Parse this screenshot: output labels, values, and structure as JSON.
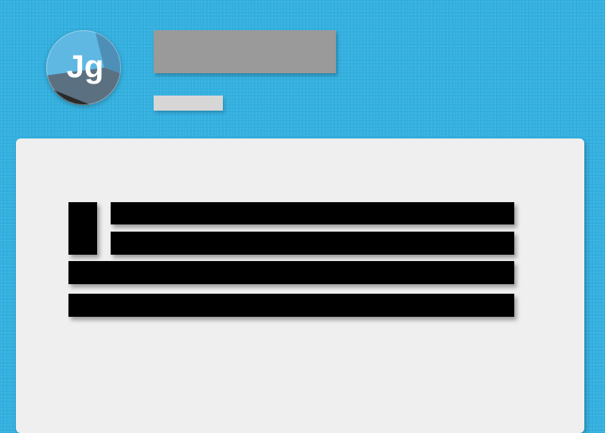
{
  "header": {
    "avatar": {
      "icon": "jg-logo-icon",
      "letters": "Jg",
      "colors": {
        "light_blue": "#5fb8e2",
        "mid_blue": "#3f9fd0",
        "slate": "#5b7080",
        "dark": "#2a2a2a",
        "text": "#ffffff"
      }
    },
    "title": "",
    "subtitle": ""
  },
  "colors": {
    "background": "#33b0e0",
    "card": "#efefef",
    "title_placeholder": "#9a9a9a",
    "subtitle_placeholder": "#d6d6d6",
    "redaction": "#000000"
  },
  "card": {
    "redacted_blocks": [
      "glyph",
      "line-1",
      "line-2",
      "line-3",
      "line-4"
    ]
  }
}
